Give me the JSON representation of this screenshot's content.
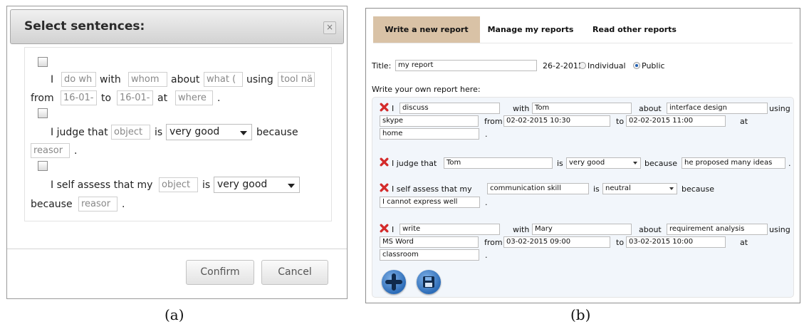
{
  "panel_a": {
    "title": "Select sentences:",
    "close": "×",
    "s1": {
      "i": "I",
      "f1": "do wh",
      "with": "with",
      "f2": "whom",
      "about": "about",
      "f3": "what (",
      "using": "using",
      "f4": "tool nä",
      "from": "from",
      "f5": "16-01-",
      "to": "to",
      "f6": "16-01-",
      "at": "at",
      "f7": "where",
      "dot": "."
    },
    "s2": {
      "text": "I judge that",
      "f1": "object",
      "is": "is",
      "select": "very good",
      "because": "because",
      "f2": "reasor",
      "dot": "."
    },
    "s3": {
      "text": "I self assess that my",
      "f1": "object",
      "is": "is",
      "select": "very good",
      "because": "because",
      "f2": "reasor",
      "dot": "."
    },
    "confirm": "Confirm",
    "cancel": "Cancel"
  },
  "panel_b": {
    "tabs": [
      "Write a new report",
      "Manage my reports",
      "Read other reports"
    ],
    "title_label": "Title:",
    "title_value": "my report",
    "date": "26-2-2015",
    "individual": "Individual",
    "public": "Public",
    "write_label": "Write your own report here:",
    "r1": {
      "i": "I",
      "verb": "discuss",
      "with": "with",
      "whom": "Tom",
      "about": "about",
      "what": "interface design",
      "using": "using",
      "tool": "skype",
      "from": "from",
      "from_val": "02-02-2015 10:30",
      "to": "to",
      "to_val": "02-02-2015 11:00",
      "at": "at",
      "where": "home",
      "dot": "."
    },
    "r2": {
      "text": "I judge that",
      "object": "Tom",
      "is": "is",
      "select": "very good",
      "because": "because",
      "reason": "he proposed many ideas",
      "dot": "."
    },
    "r3": {
      "text": "I self assess that my",
      "object": "communication skill",
      "is": "is",
      "select": "neutral",
      "because": "because",
      "reason": "I cannot express well",
      "dot": "."
    },
    "r4": {
      "i": "I",
      "verb": "write",
      "with": "with",
      "whom": "Mary",
      "about": "about",
      "what": "requirement analysis",
      "using": "using",
      "tool": "MS Word",
      "from": "from",
      "from_val": "03-02-2015 09:00",
      "to": "to",
      "to_val": "03-02-2015 10:00",
      "at": "at",
      "where": "classroom",
      "dot": "."
    }
  },
  "captions": {
    "a": "(a)",
    "b": "(b)"
  }
}
